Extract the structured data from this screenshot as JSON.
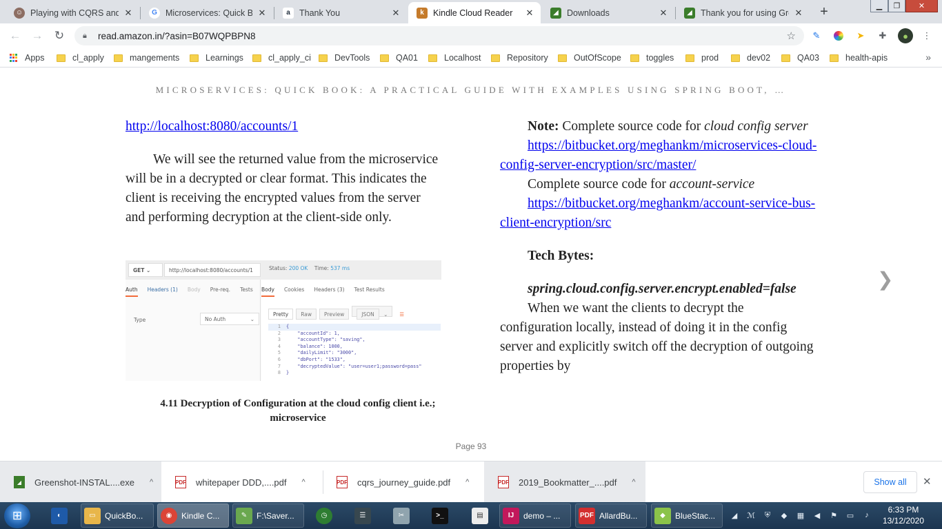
{
  "tabs": [
    {
      "title": "Playing with CQRS and E",
      "icon": "avatar-favicon",
      "color": "#8d6e63"
    },
    {
      "title": "Microservices: Quick Boo",
      "icon": "google-icon",
      "color": "#4285f4"
    },
    {
      "title": "Thank You",
      "icon": "amazon-icon",
      "color": "#232f3e"
    },
    {
      "title": "Kindle Cloud Reader",
      "icon": "kindle-icon",
      "color": "#c57b2b"
    },
    {
      "title": "Downloads",
      "icon": "greenshot-icon",
      "color": "#3b7d2b"
    },
    {
      "title": "Thank you for using Gree",
      "icon": "greenshot-icon",
      "color": "#3b7d2b"
    }
  ],
  "toolbar": {
    "url": "read.amazon.in/?asin=B07WQPBPN8"
  },
  "bookmarks": [
    {
      "label": "Apps",
      "type": "apps"
    },
    {
      "label": "cl_apply",
      "type": "folder"
    },
    {
      "label": "mangements",
      "type": "folder"
    },
    {
      "label": "Learnings",
      "type": "folder"
    },
    {
      "label": "cl_apply_ci",
      "type": "folder"
    },
    {
      "label": "DevTools",
      "type": "folder"
    },
    {
      "label": "QA01",
      "type": "folder"
    },
    {
      "label": "Localhost",
      "type": "folder"
    },
    {
      "label": "Repository",
      "type": "folder"
    },
    {
      "label": "OutOfScope",
      "type": "folder"
    },
    {
      "label": "toggles",
      "type": "folder"
    },
    {
      "label": "prod",
      "type": "folder"
    },
    {
      "label": "dev02",
      "type": "folder"
    },
    {
      "label": "QA03",
      "type": "folder"
    },
    {
      "label": "health-apis",
      "type": "folder"
    }
  ],
  "reader": {
    "book_title": "MICROSERVICES: QUICK BOOK: A PRACTICAL GUIDE WITH EXAMPLES USING SPRING BOOT, …",
    "left": {
      "link": "http://localhost:8080/accounts/1",
      "paragraph": "We will see the returned value from the microservice will be in a decrypted or clear format. This indicates the client is receiving the encrypted values from the server and performing decryption at the client-side only.",
      "caption": "4.11 Decryption of Configuration at the cloud config client i.e.; microservice"
    },
    "right": {
      "note_label": "Note:",
      "note_text": "Complete source code for",
      "note_em": "cloud config server",
      "link1": "https://bitbucket.org/meghankm/microservices-cloud-config-server-encryption/src/master/",
      "source2_text": "Complete source code for",
      "source2_em": "account-service",
      "link2": "https://bitbucket.org/meghankm/account-service-bus-client-encryption/src",
      "tech_bytes": "Tech Bytes:",
      "property": "spring.cloud.config.server.encrypt.enabled=false",
      "paragraph": "When we want the clients to decrypt the configuration locally, instead of doing it in the config server and explicitly switch off the decryption of outgoing properties by"
    },
    "page_label": "Page 93"
  },
  "postman": {
    "method": "GET",
    "url": "http://localhost:8080/accounts/1",
    "status_label": "Status:",
    "status": "200 OK",
    "time_label": "Time:",
    "time": "537 ms",
    "req_tabs": [
      "Auth",
      "Headers (1)",
      "Body",
      "Pre-req.",
      "Tests"
    ],
    "resp_tabs": [
      "Body",
      "Cookies",
      "Headers (3)",
      "Test Results"
    ],
    "type_label": "Type",
    "auth_value": "No Auth",
    "view_buttons": [
      "Pretty",
      "Raw",
      "Preview",
      "JSON"
    ],
    "code_lines": [
      "{",
      "    \"accountId\": 1,",
      "    \"accountType\": \"saving\",",
      "    \"balance\": 1000,",
      "    \"dailyLimit\": \"3000\",",
      "    \"dbPort\": \"1533\",",
      "    \"decryptedValue\": \"user=user1;password=pass\"",
      "}"
    ]
  },
  "downloads": {
    "items": [
      {
        "name": "Greenshot-INSTAL....exe",
        "icon": "installer-icon"
      },
      {
        "name": "whitepaper DDD,....pdf",
        "icon": "pdf-icon"
      },
      {
        "name": "cqrs_journey_guide.pdf",
        "icon": "pdf-icon"
      },
      {
        "name": "2019_Bookmatter_....pdf",
        "icon": "pdf-icon"
      }
    ],
    "show_all": "Show all"
  },
  "taskbar": {
    "items": [
      {
        "label": "QuickBo...",
        "icon": "folder-icon",
        "color": "#e8b64a"
      },
      {
        "label": "Kindle C...",
        "icon": "chrome-icon",
        "color": "#db4437"
      },
      {
        "label": "F:\\Saver...",
        "icon": "notepadpp-icon",
        "color": "#6aa84f"
      },
      {
        "label": "demo – ...",
        "icon": "intellij-icon",
        "color": "#c2185b"
      },
      {
        "label": "AllardBu...",
        "icon": "pdf-reader-icon",
        "color": "#d32f2f"
      },
      {
        "label": "BlueStac...",
        "icon": "bluestacks-icon",
        "color": "#8bc34a"
      }
    ],
    "time": "6:33 PM",
    "date": "13/12/2020"
  }
}
